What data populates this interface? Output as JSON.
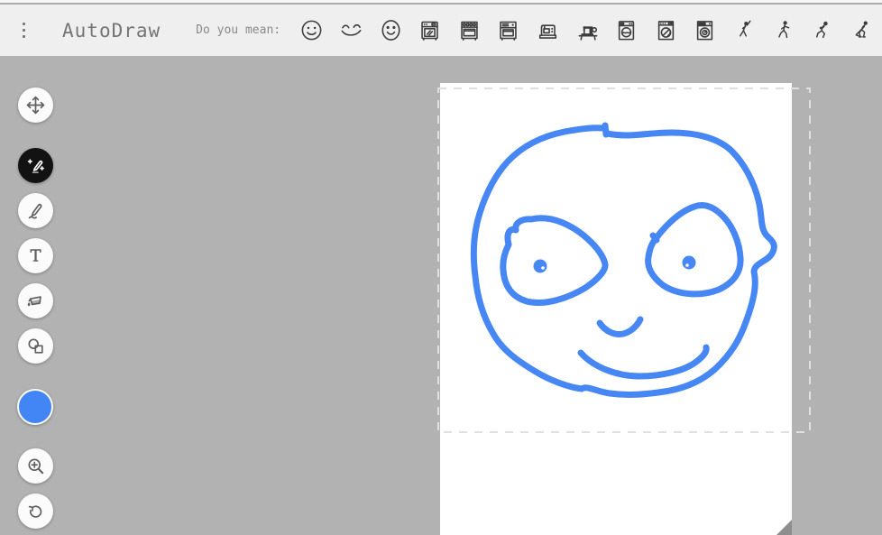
{
  "app": {
    "title": "AutoDraw"
  },
  "topbar": {
    "prompt": "Do you mean:",
    "suggestions": [
      "smiley-face",
      "smile",
      "smiley-oval-face",
      "oven",
      "stove",
      "oven-with-vents",
      "sewing-machine",
      "vintage-sewing-machine",
      "washing-machine",
      "washing-machine-front-loader",
      "dryer",
      "baseball-batter",
      "running-person",
      "football-player",
      "hockey-player"
    ]
  },
  "toolbar": {
    "tools": [
      {
        "name": "select",
        "icon": "move-icon",
        "selected": false
      },
      {
        "name": "auto-draw",
        "icon": "magic-pencil-icon",
        "selected": true
      },
      {
        "name": "draw",
        "icon": "pencil-icon",
        "selected": false
      },
      {
        "name": "type",
        "icon": "text-icon",
        "selected": false
      },
      {
        "name": "fill",
        "icon": "paint-bucket-icon",
        "selected": false
      },
      {
        "name": "shape",
        "icon": "shapes-icon",
        "selected": false
      },
      {
        "name": "color",
        "icon": "color-swatch",
        "selected": false
      },
      {
        "name": "zoom",
        "icon": "magnifier-plus-icon",
        "selected": false
      },
      {
        "name": "undo",
        "icon": "undo-arrow-icon",
        "selected": false
      }
    ],
    "current_color": "#4285f4",
    "text_tool_glyph": "T"
  },
  "canvas": {
    "content": "hand-drawn smiley face sketch",
    "stroke_color": "#4687f4",
    "selection_box_visible": true
  },
  "colors": {
    "background": "#b2b2b2",
    "topbar": "#efefef",
    "accent_blue": "#4285f4",
    "icon_gray": "#5f5f5f",
    "text_gray": "#757575"
  }
}
